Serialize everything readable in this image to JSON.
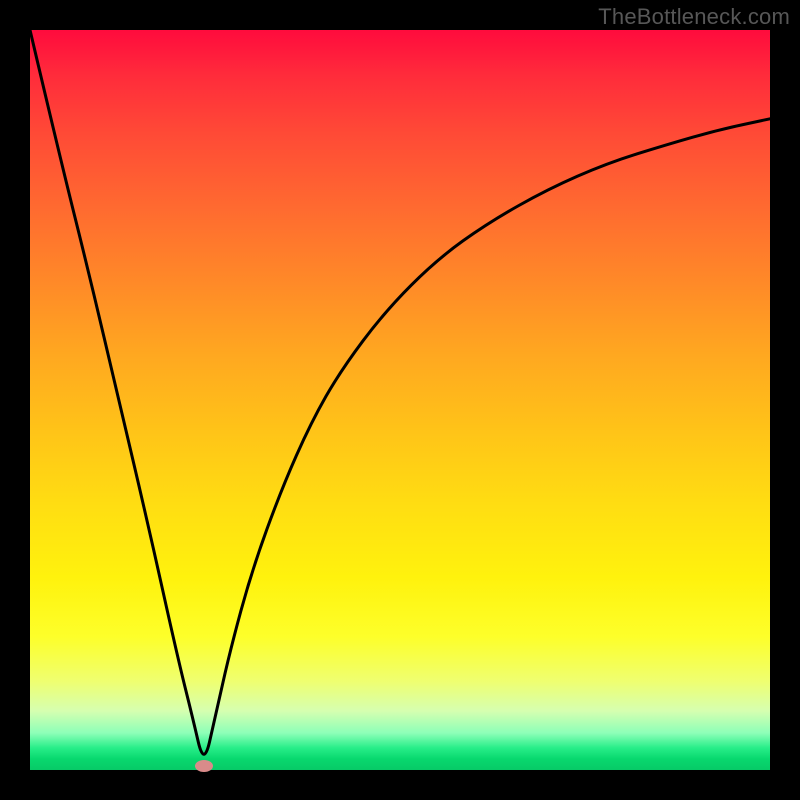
{
  "watermark": "TheBottleneck.com",
  "colors": {
    "frame": "#000000",
    "curve": "#000000",
    "marker": "#d98b8a"
  },
  "chart_data": {
    "type": "line",
    "title": "",
    "xlabel": "",
    "ylabel": "",
    "xlim": [
      0,
      100
    ],
    "ylim": [
      0,
      100
    ],
    "grid": false,
    "note": "V-shaped bottleneck curve over a vertical red-to-green gradient; minimum sits near x≈24 at the baseline. Y values are read as height from the bottom edge (0=bottom, 100=top).",
    "series": [
      {
        "name": "bottleneck-curve",
        "x": [
          0,
          4,
          8,
          12,
          16,
          20,
          22,
          23.5,
          25,
          27,
          30,
          34,
          38,
          42,
          48,
          55,
          62,
          70,
          78,
          86,
          93,
          100
        ],
        "y": [
          100,
          83,
          67,
          50,
          33,
          15,
          7,
          0.5,
          7,
          16,
          27,
          38,
          47,
          54,
          62,
          69,
          74,
          78.5,
          82,
          84.5,
          86.5,
          88
        ]
      }
    ],
    "marker": {
      "x": 23.5,
      "y": 0.5
    }
  }
}
